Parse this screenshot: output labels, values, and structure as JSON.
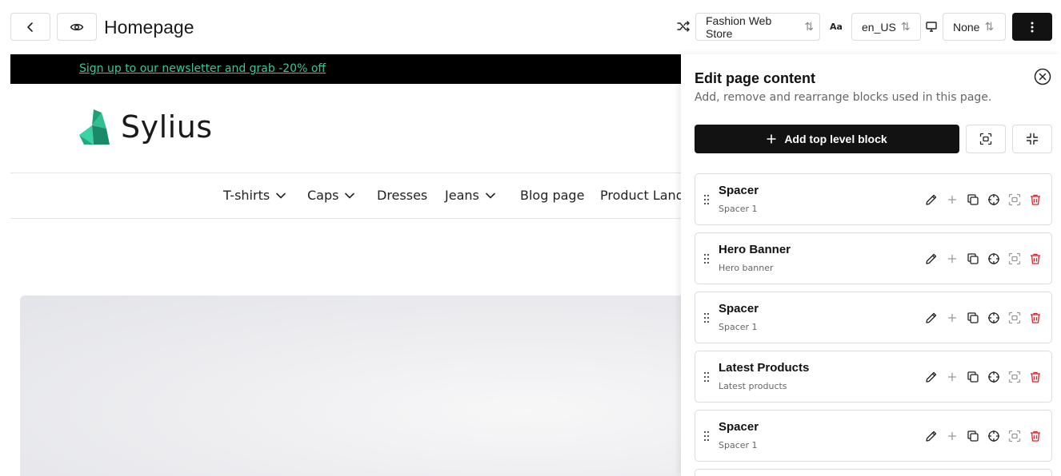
{
  "toolbar": {
    "title": "Homepage",
    "channel": "Fashion Web Store",
    "locale": "en_US",
    "device": "None",
    "sort_arrows": "⇅"
  },
  "icons": {
    "back": "chevron-left-icon",
    "preview": "eye-icon",
    "channel": "shuffle-icon",
    "locale": "text-case-icon",
    "device": "monitor-icon",
    "more": "more-vertical-icon"
  },
  "preview": {
    "promo_text": "Sign up to our newsletter and grab -20% off",
    "logo_text": "Sylius",
    "nav": [
      {
        "label": "T-shirts"
      },
      {
        "label": "Caps"
      },
      {
        "label": "Dresses"
      },
      {
        "label": "Jeans"
      },
      {
        "label": "Blog page"
      },
      {
        "label": "Product Land"
      }
    ]
  },
  "panel": {
    "title": "Edit page content",
    "subtitle": "Add, remove and rearrange blocks used in this page.",
    "add_label": "Add top level block",
    "blocks": [
      {
        "title": "Spacer",
        "sub": "Spacer 1"
      },
      {
        "title": "Hero Banner",
        "sub": "Hero banner"
      },
      {
        "title": "Spacer",
        "sub": "Spacer 1"
      },
      {
        "title": "Latest Products",
        "sub": "Latest products"
      },
      {
        "title": "Spacer",
        "sub": "Spacer 1"
      }
    ]
  },
  "colors": {
    "accent": "#3ac79b",
    "danger": "#e0222b",
    "dark": "#121212"
  }
}
